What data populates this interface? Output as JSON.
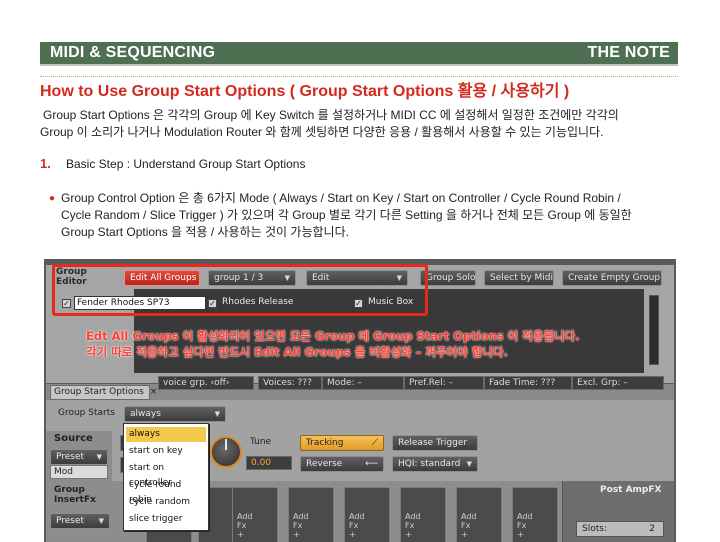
{
  "header": {
    "left": "MIDI & SEQUENCING",
    "right": "THE NOTE",
    "bar_color": "#4f6f53"
  },
  "title": "How to Use Group Start Options ( Group Start Options 활용 / 사용하기 )",
  "intro": {
    "line1": "Group Start Options 은 각각의 Group 에 Key Switch 를 설정하거나 MIDI CC 에 설정해서 일정한 조건에만 각각의",
    "line2": "Group 이 소리가 나거나 Modulation Router 와 함께 셋팅하면 다양한 응용 / 활용해서 사용할 수 있는 기능입니다."
  },
  "step": {
    "number": "1.",
    "text": "Basic Step : Understand Group Start Options"
  },
  "bullet": {
    "line1": "Group Control Option 은 총 6가지 Mode ( Always / Start on Key / Start on Controller / Cycle Round Robin /",
    "line2": "Cycle Random / Slice Trigger ) 가 있으며 각 Group 별로 각기 다른 Setting 을 하거나 전체 모든 Group 에 동일한",
    "line3": "Group Start Options 을 적용 / 사용하는 것이 가능합니다."
  },
  "ui": {
    "group_editor_label_1": "Group",
    "group_editor_label_2": "Editor",
    "edit_all_groups": "Edit All Groups",
    "group_select": "group 1 / 3",
    "edit_menu": "Edit",
    "group_solo": "Group Solo",
    "select_by_midi": "Select by Midi",
    "create_empty_group": "Create Empty Group",
    "group_name": "Fender Rhodes SP73",
    "rhodes_release": "Rhodes Release",
    "music_box": "Music Box",
    "note_line1": "Edt All Groups 이 활성화되어 있으면 모든 Group 에 Group Start Options 이 적용됩니다.",
    "note_line2": "각기 따로 적용하고 싶다면 반드시 Edit All Groups 을 비활성화 – 꺼주어야 합니다.",
    "tab_label": "Group Start Options",
    "tab_close": "×",
    "voice_grp": "voice grp. ‹off›",
    "voices": "Voices: ???",
    "mode": "Mode: –",
    "pref_rel": "Pref.Rel: –",
    "fade_time": "Fade Time: ???",
    "excl_grp": "Excl. Grp: –",
    "group_starts_label": "Group Starts",
    "group_starts_value": "always",
    "source": "Source",
    "preset": "Preset",
    "mod": "Mod",
    "tune": "Tune",
    "tune_value": "0.00",
    "tracking": "Tracking",
    "reverse": "Reverse",
    "release_trigger": "Release Trigger",
    "hqi": "HQI: standard",
    "group_insertfx_1": "Group",
    "group_insertfx_2": "InsertFx",
    "preset2": "Preset",
    "add_fx_1": "Add",
    "add_fx_2": "Fx",
    "post_ampfx": "Post AmpFX",
    "slots_label": "Slots:",
    "slots_value": "2",
    "options": [
      "always",
      "start on key",
      "start on controller",
      "cycle round robin",
      "cycle random",
      "slice trigger"
    ],
    "accent_red": "#e8281d",
    "highlight": "#f2c94c"
  }
}
